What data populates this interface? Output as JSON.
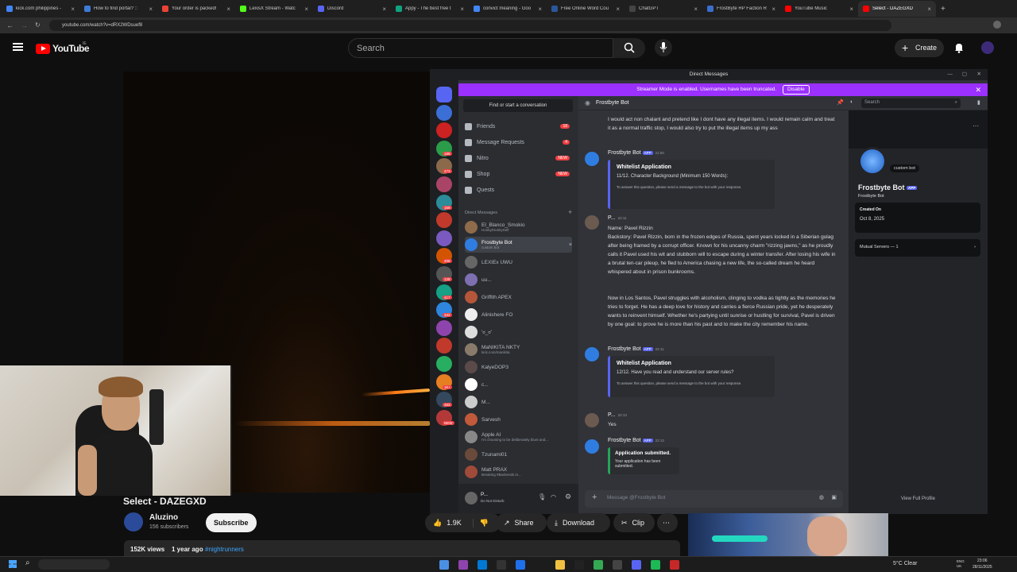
{
  "browser": {
    "tabs": [
      {
        "title": "kick.com philippines -",
        "color": "#4285f4"
      },
      {
        "title": "How to find portal? ::",
        "color": "#3d7bd6"
      },
      {
        "title": "Your order is packed!",
        "color": "#ea4335"
      },
      {
        "title": "LexisX Stream - Watc",
        "color": "#53fc18"
      },
      {
        "title": "Discord",
        "color": "#5865f2"
      },
      {
        "title": "Appy - The best free t",
        "color": "#10a37f"
      },
      {
        "title": "convict meaning - Goo",
        "color": "#4285f4"
      },
      {
        "title": "Free Online Word Cou",
        "color": "#2b579a"
      },
      {
        "title": "ChatGPT",
        "color": "#444"
      },
      {
        "title": "FrostByte RP Faction R",
        "color": "#3a6ecf"
      },
      {
        "title": "YouTube Music",
        "color": "#ff0000"
      },
      {
        "title": "Select - DAZEGXD",
        "color": "#ff0000",
        "active": true
      }
    ],
    "url": "youtube.com/watch?v=dRX2WDsuef8"
  },
  "youtube": {
    "logo": "YouTube",
    "region": "IE",
    "search_placeholder": "Search",
    "create_label": "Create",
    "video_title": "Select - DAZEGXD",
    "channel": "Aluzino",
    "subscribers": "156 subscribers",
    "subscribe_label": "Subscribe",
    "likes": "1.9K",
    "share_label": "Share",
    "download_label": "Download",
    "clip_label": "Clip",
    "views": "152K views",
    "age": "1 year ago",
    "hashtag": "#nightrunners"
  },
  "discord": {
    "window_title": "Direct Messages",
    "streamer_notice": "Streamer Mode is enabled. Usernames have been truncated.",
    "disable_label": "Disable",
    "find_label": "Find or start a conversation",
    "nav": [
      {
        "label": "Friends",
        "badge": "18",
        "badge_color": "#f23f42"
      },
      {
        "label": "Message Requests",
        "badge": "4",
        "badge_color": "#f23f42"
      },
      {
        "label": "Nitro",
        "badge": "NEW",
        "badge_color": "#f23f42"
      },
      {
        "label": "Shop",
        "badge": "NEW",
        "badge_color": "#f23f42"
      },
      {
        "label": "Quests",
        "badge": "",
        "badge_color": ""
      }
    ],
    "dm_header": "Direct Messages",
    "dms": [
      {
        "name": "El_Blanco_Smokio",
        "sub": "Honky/HonkySelf",
        "color": "#8e6b4a"
      },
      {
        "name": "Frostbyte Bot",
        "sub": "custom bot",
        "color": "#2f7de1",
        "active": true
      },
      {
        "name": "LEXIEx  UWU",
        "sub": "",
        "color": "#666"
      },
      {
        "name": "uu...",
        "sub": "",
        "color": "#7d6fb0"
      },
      {
        "name": "Griffith  APEX",
        "sub": "",
        "color": "#b5563a"
      },
      {
        "name": "Alinishere  FO",
        "sub": "",
        "color": "#eee"
      },
      {
        "name": "'ಠ_ಠ'",
        "sub": "",
        "color": "#ddd"
      },
      {
        "name": "MaNIKITA  NKTY",
        "sub": "kick.com/manikita",
        "color": "#8a7a6a"
      },
      {
        "name": "KalyeDOP3",
        "sub": "",
        "color": "#5a4a4a"
      },
      {
        "name": "c...",
        "sub": "",
        "color": "#fff"
      },
      {
        "name": "M...",
        "sub": "",
        "color": "#ccc"
      },
      {
        "name": "Sarvesh",
        "sub": "",
        "color": "#c05a3a"
      },
      {
        "name": "Apple AI",
        "sub": "I'm choosing to be deliberately blunt and...",
        "color": "#888"
      },
      {
        "name": "Tzunami01",
        "sub": "",
        "color": "#6a4a3a"
      },
      {
        "name": "Matt  PRAX",
        "sub": "Breaking #Backends in...",
        "color": "#a04a3a"
      }
    ],
    "user_name": "P...",
    "user_status": "Do Not Disturb",
    "chat_header": "Frostbyte Bot",
    "chat_search": "Search",
    "msg_top": "I would act non chalant and pretend like I dont have any illegal items. I would remain calm and treat it as a normal traffic stop, I would also try to put the illegal items up my ass",
    "bot_name": "Frostbyte Bot",
    "app_tag": "APP",
    "ts1": "21:50",
    "embed1_title": "Whitelist Application",
    "embed1_desc": "11/12. Character Background (Minimum 150 Words):",
    "embed_footer": "To answer this question, please send a message to the bot with your response.",
    "user_author": "P...",
    "ts2": "22:11",
    "msg_name": "Name: Pavel Rizzin",
    "msg_backstory": "Backstory: Pavel Rizzin, born in the frozen edges of Russia, spent years locked in a Siberian gulag after being framed by a corrupt officer. Known for his uncanny charm \"rizzing jawns,\" as he proudly calls it Pavel used his wit and stubborn will to escape during a winter transfer. After losing his wife in a brutal ten-car pileup, he fled to America chasing a new life, the so-called dream he heard whispered about in prison bunkrooms.",
    "msg_para2": "Now in Los Santos, Pavel struggles with alcoholism, clinging to vodka as tightly as the memories he tries to forget. He has a deep love for history and carries a fierce Russian pride, yet he desperately wants to reinvent himself. Whether he's partying until sunrise or hustling for survival, Pavel is driven by one goal: to prove he is more than his past and to make the city remember his name.",
    "ts3": "22:11",
    "embed2_title": "Whitelist Application",
    "embed2_desc": "12/12. Have you read and understand our server rules?",
    "ts4": "22:13",
    "msg_yes": "Yes",
    "ts5": "22:13",
    "embed3_title": "Application submitted.",
    "embed3_desc": "Your application has been submitted.",
    "input_placeholder": "Message @Frostbyte Bot",
    "profile_tag": "custom bot",
    "profile_name": "Frostbyte Bot",
    "profile_user": "Frostbyte Bot",
    "created_label": "Created On",
    "created_date": "Oct 8, 2025",
    "mutual": "Mutual Servers — 1",
    "view_profile": "View Full Profile",
    "server_badges": [
      "",
      "",
      "",
      "188",
      "473",
      "",
      "159",
      "",
      "",
      "208",
      "128",
      "417",
      "332",
      "",
      "",
      "",
      "1K+",
      "463",
      "NEW"
    ]
  },
  "taskbar": {
    "weather": "5°C  Clear",
    "lang": "ENG UK",
    "time": "23:06",
    "date": "28/11/2025"
  }
}
